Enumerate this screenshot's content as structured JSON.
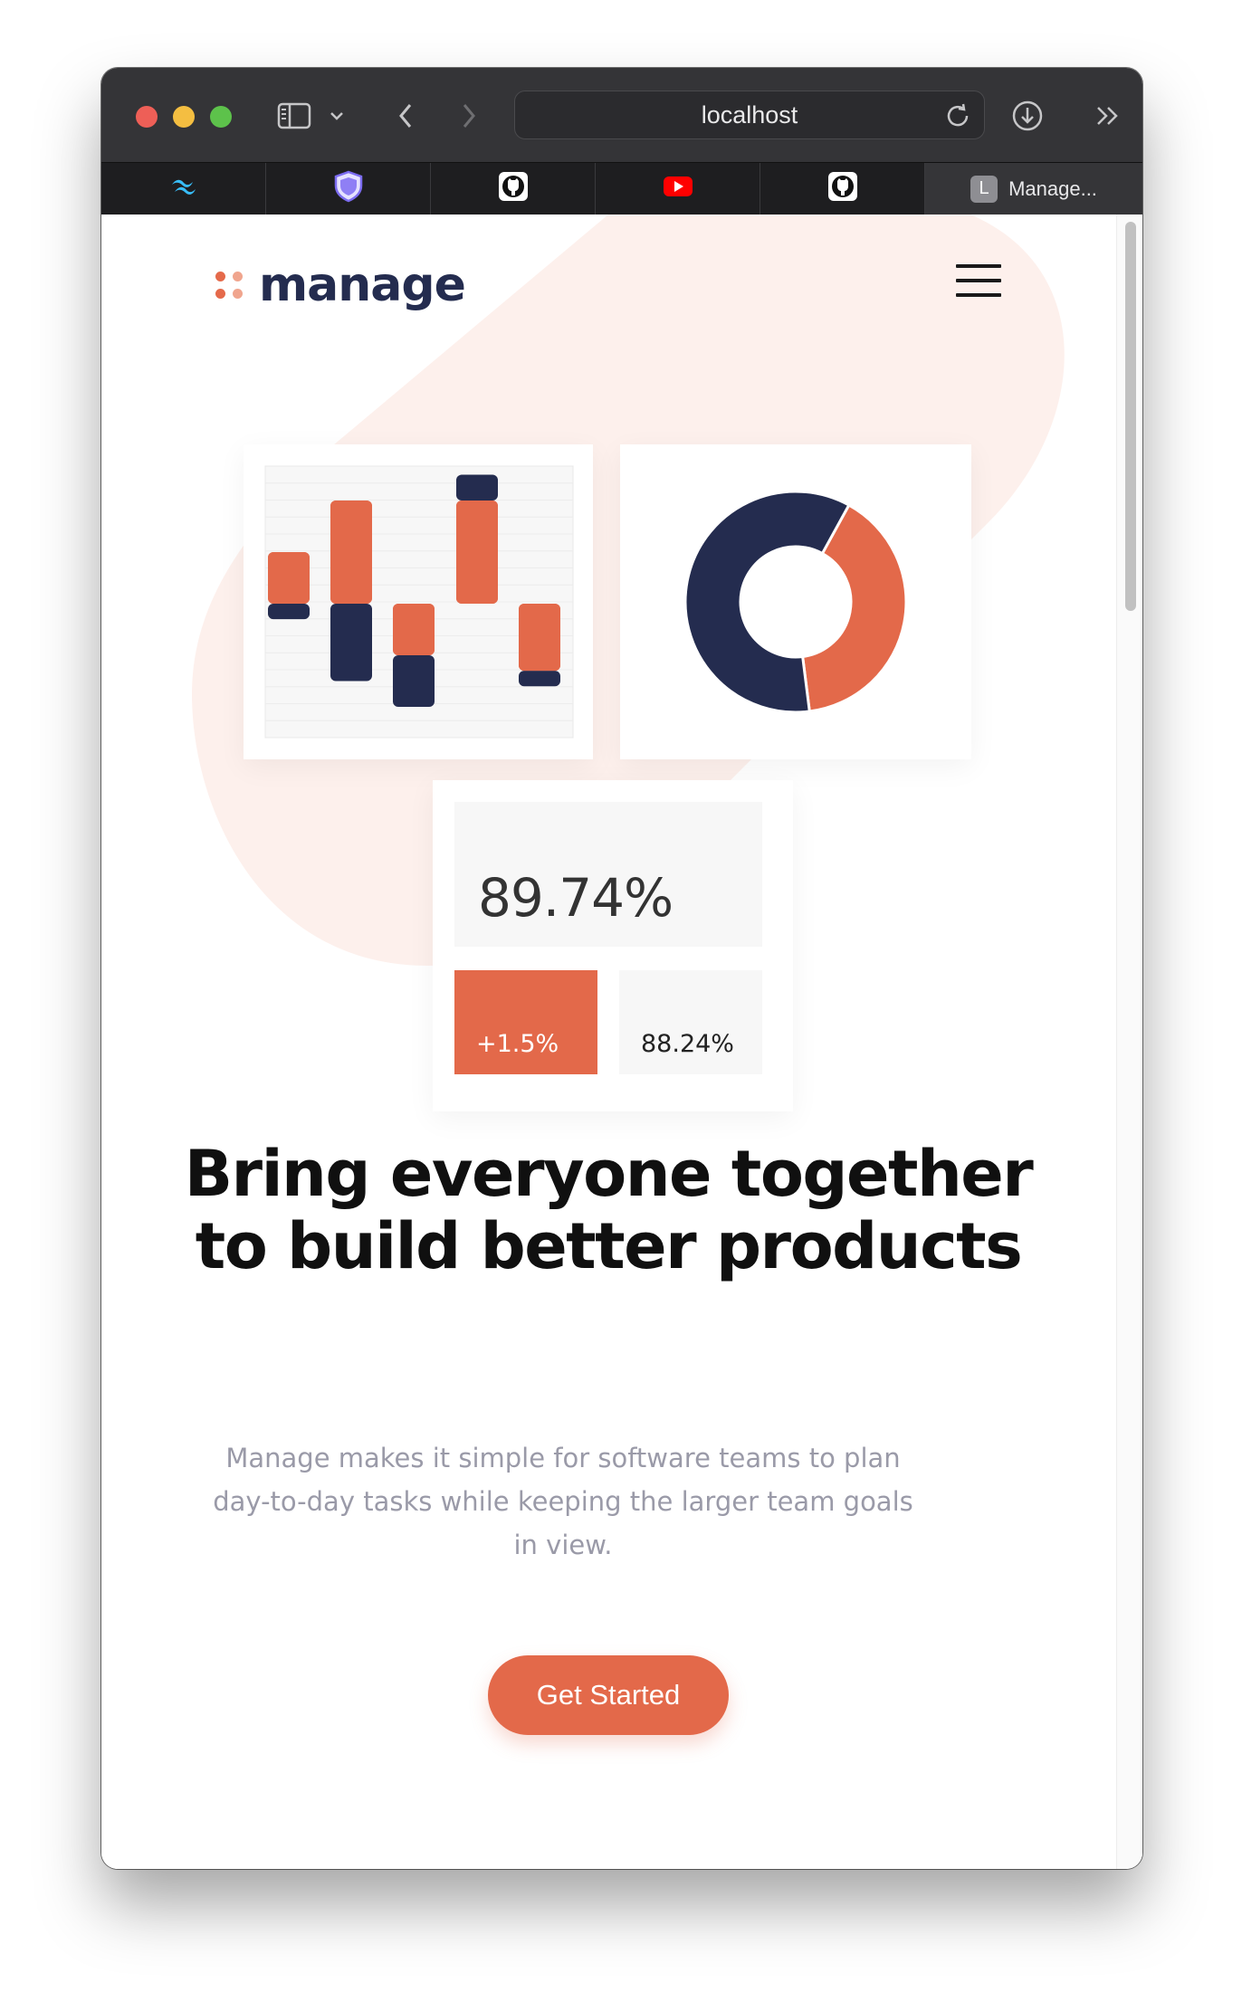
{
  "browser": {
    "url": "localhost",
    "tabs": [
      {
        "icon": "tailwind-icon"
      },
      {
        "icon": "shield-icon"
      },
      {
        "icon": "github-icon"
      },
      {
        "icon": "youtube-icon"
      },
      {
        "icon": "github-icon"
      },
      {
        "icon": "letter-avatar-icon",
        "letter": "L",
        "title": "Manage..."
      }
    ]
  },
  "header": {
    "logo_text": "manage",
    "menu_icon": "hamburger-icon"
  },
  "hero": {
    "stats": {
      "main": "89.74%",
      "change": "+1.5%",
      "secondary": "88.24%"
    },
    "headline_line1": "Bring everyone together",
    "headline_line2": "to build better products",
    "description": "Manage makes it simple for software teams to plan day-to-day tasks while keeping the larger team goals in view.",
    "cta_label": "Get Started"
  },
  "colors": {
    "accent": "#e3694a",
    "navy": "#242c4f",
    "blob": "#fdf0ec"
  },
  "chart_data": [
    {
      "type": "bar",
      "series": [
        {
          "values": [
            1,
            2,
            -1,
            2,
            -1.3
          ]
        },
        {
          "values": [
            -0.3,
            -1.5,
            -1,
            0.5,
            -0.3
          ]
        }
      ]
    },
    {
      "type": "pie",
      "values": [
        40,
        60
      ]
    }
  ]
}
